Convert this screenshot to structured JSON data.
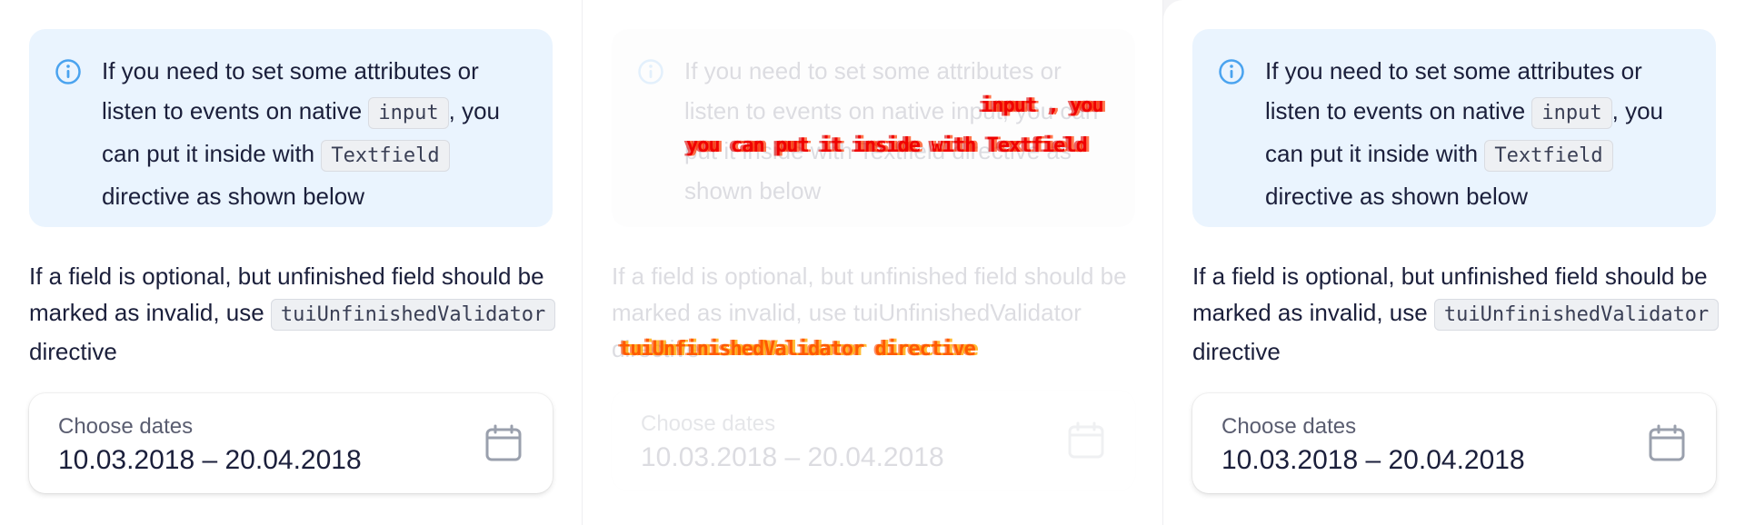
{
  "notice": {
    "text_part1": "If you need to set some attributes or listen to events on native ",
    "code_input": "input",
    "text_part2": ", you can put it inside with ",
    "code_textfield": "Textfield",
    "text_part3": " directive as shown below"
  },
  "paragraph": {
    "text_part1": "If a field is optional, but unfinished field should be marked as invalid, use ",
    "code_validator": "tuiUnfinishedValidator",
    "text_part2": " directive"
  },
  "date_input": {
    "label": "Choose dates",
    "value": "10.03.2018 – 20.04.2018"
  },
  "glitch": {
    "line1": "input , you",
    "line2": "you can put it inside with Textfield",
    "line3": "tuiUnfinishedValidator directive"
  },
  "colors": {
    "notice_bg": "#eaf4fe",
    "info_icon": "#4aa3ef",
    "glitch_red": "#f00000",
    "glitch_orange": "#ff5a00"
  },
  "icons": [
    "info-icon",
    "calendar-icon"
  ]
}
